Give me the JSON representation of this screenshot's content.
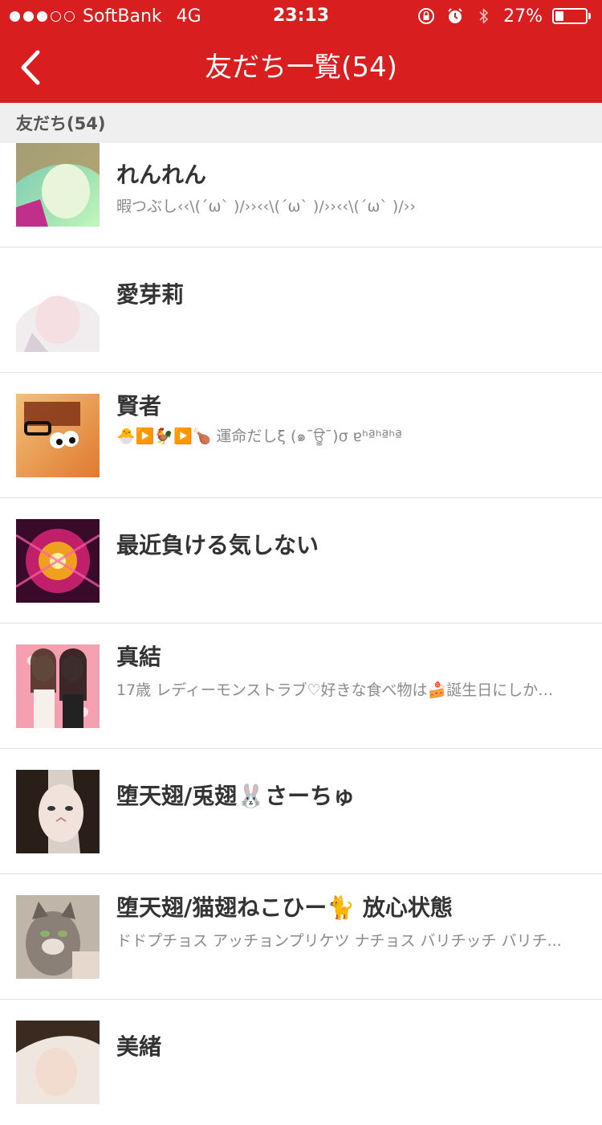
{
  "status_bar": {
    "carrier": "SoftBank",
    "network": "4G",
    "time": "23:13",
    "battery_text": "27%",
    "battery_level": 0.27,
    "signal_bars_filled": 3,
    "signal_bars_total": 5,
    "icons": [
      "orientation-lock-icon",
      "alarm-icon",
      "bluetooth-icon",
      "battery-icon"
    ]
  },
  "nav": {
    "title": "友だち一覧(54)",
    "back_icon": "chevron-left-icon"
  },
  "section": {
    "header": "友だち(54)"
  },
  "friends": [
    {
      "name": "れんれん",
      "status": "暇つぶし‹‹\\(´ω` )/››‹‹\\(´ω` )/››‹‹\\(´ω` )/››"
    },
    {
      "name": "愛芽莉",
      "status": ""
    },
    {
      "name": "賢者",
      "status": "🐣▶️🐓▶️🍗 運命だしξ (๑¯ਊ¯)σ ɐʰªʰªʰª"
    },
    {
      "name": "最近負ける気しない",
      "status": ""
    },
    {
      "name": "真結",
      "status": "17歳 レディーモンストラブ♡好きな食べ物は🍰誕生日にしか食..."
    },
    {
      "name": "堕天翅/兎翅🐰さーちゅ",
      "status": ""
    },
    {
      "name": "堕天翅/猫翅ねこひー🐈 放心状態",
      "status": "ドドプチョス アッチョンプリケツ ナチョス バリチッチ バリチ..."
    },
    {
      "name": "美緒",
      "status": ""
    }
  ],
  "colors": {
    "brand_red": "#d81e1e",
    "section_bg": "#efefef",
    "name_text": "#333333",
    "status_text": "#8a8a8a"
  }
}
